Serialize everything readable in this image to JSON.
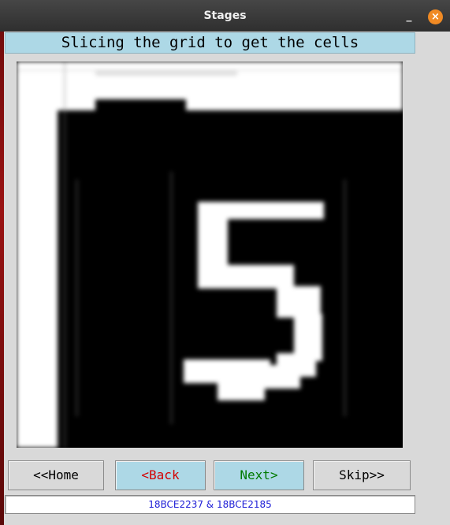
{
  "window": {
    "title": "Stages",
    "minimize_glyph": "_",
    "close_glyph": "×",
    "icons": [
      "minimize-icon",
      "close-icon"
    ]
  },
  "stage": {
    "label": "Slicing the grid to get the cells"
  },
  "image": {
    "depicted_digit": "5"
  },
  "buttons": {
    "home": "<<Home",
    "back": "<Back",
    "next": "Next>",
    "skip": "Skip>>"
  },
  "footer": {
    "credits": "18BCE2237 & 18BCE2185"
  },
  "colors": {
    "accent_panel": "#add8e6",
    "back_text": "#d40000",
    "next_text": "#007a00",
    "credits_text": "#1b1bd6",
    "close_button": "#f08a24"
  }
}
